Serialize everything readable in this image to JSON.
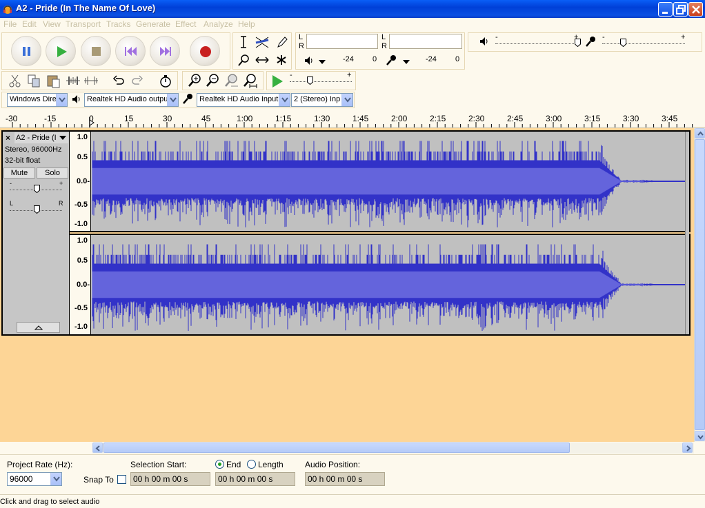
{
  "window": {
    "title": "A2 - Pride (In The Name Of Love)",
    "colors": {
      "titlebar": "#0a50e2",
      "waveform": "#3232c8",
      "waveform_rms": "#6464dc",
      "track_bg": "#fdd596",
      "background": "#fdf9ed"
    }
  },
  "menu": [
    "File",
    "Edit",
    "View",
    "Transport",
    "Tracks",
    "Generate",
    "Effect",
    "Analyze",
    "Help"
  ],
  "transport": {
    "buttons": [
      "pause-icon",
      "play-icon",
      "stop-icon",
      "skip-start-icon",
      "skip-end-icon",
      "record-icon"
    ]
  },
  "tools": [
    "selection-icon",
    "envelope-icon",
    "draw-icon",
    "zoom-icon",
    "timeshift-icon",
    "multi-tool-icon"
  ],
  "meters": {
    "playback": {
      "l": "L",
      "r": "R",
      "db_left": "-24",
      "db_right": "0"
    },
    "record": {
      "l": "L",
      "r": "R",
      "db_left": "-24",
      "db_right": "0"
    }
  },
  "mixer": {
    "minus": "-",
    "plus": "+"
  },
  "play_at_speed": {
    "minus": "-",
    "plus": "+"
  },
  "device": {
    "host": "Windows Dire",
    "output": "Realtek HD Audio outpu",
    "input": "Realtek HD Audio Input",
    "channels": "2 (Stereo) Inp"
  },
  "ruler": {
    "labels": [
      "-30",
      "-15",
      "0",
      "15",
      "30",
      "45",
      "1:00",
      "1:15",
      "1:30",
      "1:45",
      "2:00",
      "2:15",
      "2:30",
      "2:45",
      "3:00",
      "3:15",
      "3:30",
      "3:45"
    ]
  },
  "track": {
    "name": "A2 - Pride (I",
    "format": "Stereo, 96000Hz",
    "sample": "32-bit float",
    "mute": "Mute",
    "solo": "Solo",
    "gain_minus": "-",
    "gain_plus": "+",
    "pan_left": "L",
    "pan_right": "R",
    "close": "×",
    "vruler": [
      "1.0",
      "0.5",
      "0.0-",
      "-0.5",
      "-1.0"
    ]
  },
  "selection": {
    "project_rate_label": "Project Rate (Hz):",
    "project_rate": "96000",
    "snap_to": "Snap To",
    "selection_start_label": "Selection Start:",
    "end_label": "End",
    "length_label": "Length",
    "audio_position_label": "Audio Position:",
    "start_time": "00 h 00 m 00 s",
    "end_time": "00 h 00 m 00 s",
    "position_time": "00 h 00 m 00 s"
  },
  "status": {
    "text": "Click and drag to select audio"
  }
}
